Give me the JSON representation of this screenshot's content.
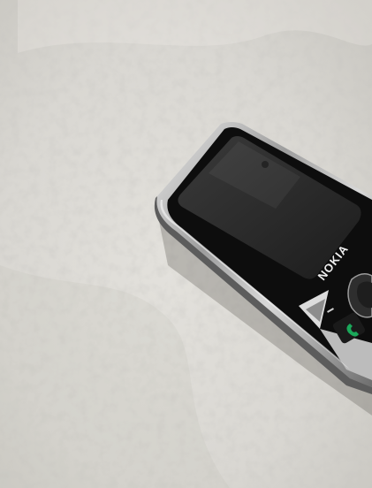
{
  "photo": {
    "subject": "mobile-phone",
    "background": "fleece-blanket",
    "colors": {
      "blanket": "#d9d7d2",
      "blanket_shadow": "#c7c5bf",
      "blanket_highlight": "#ebe9e4",
      "chrome": "#bdbdbd",
      "chrome_dark": "#6e6e6e",
      "screen": "#2a2a2a",
      "bezel": "#0d0d0d",
      "call_key": "#1aa85a"
    },
    "phone": {
      "brand_label": "NOKIA"
    }
  }
}
